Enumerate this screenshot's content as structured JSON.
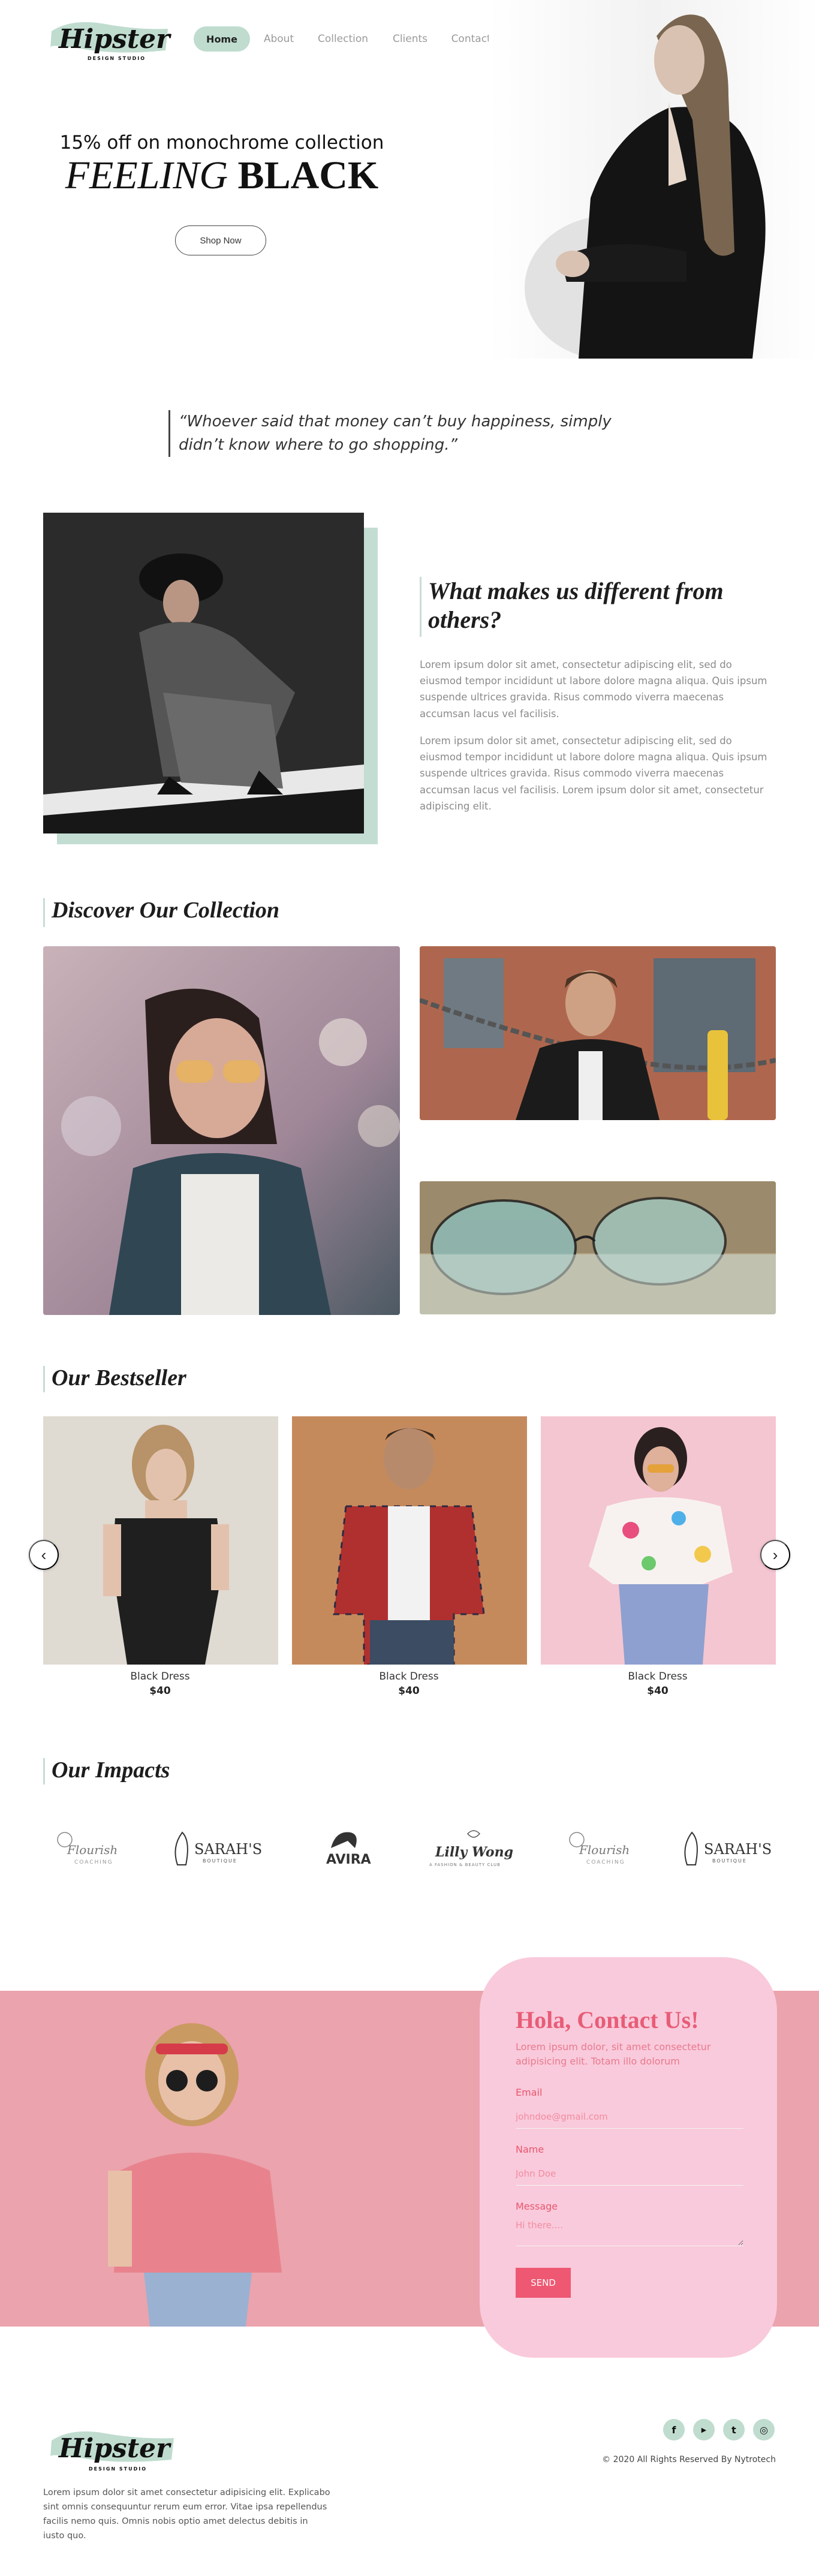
{
  "brand": {
    "logo_text": "Hipster",
    "logo_sub": "DESIGN STUDIO"
  },
  "nav": [
    {
      "label": "Home",
      "active": true
    },
    {
      "label": "About"
    },
    {
      "label": "Collection"
    },
    {
      "label": "Clients"
    },
    {
      "label": "Contact Us"
    }
  ],
  "hero": {
    "subtitle": "15% off on monochrome collection",
    "title_italic": "FEELING",
    "title_bold": "BLACK",
    "cta": "Shop Now"
  },
  "quote": "“Whoever said that money can’t buy happiness, simply didn’t know where to go shopping.”",
  "difference": {
    "title": "What makes us different from others?",
    "paragraphs": [
      "Lorem ipsum dolor sit amet, consectetur adipiscing elit, sed do eiusmod tempor incididunt ut labore dolore magna aliqua. Quis ipsum suspende ultrices gravida. Risus commodo viverra maecenas accumsan lacus vel facilisis.",
      "Lorem ipsum dolor sit amet, consectetur adipiscing elit, sed do eiusmod tempor incididunt ut labore dolore magna aliqua. Quis ipsum suspende ultrices gravida. Risus commodo viverra maecenas accumsan lacus vel facilisis. Lorem ipsum dolor sit amet, consectetur adipiscing elit."
    ]
  },
  "collection": {
    "title": "Discover Our Collection"
  },
  "bestseller": {
    "title": "Our Bestseller",
    "prev_icon": "‹",
    "next_icon": "›",
    "products": [
      {
        "name": "Black Dress",
        "price": "$40"
      },
      {
        "name": "Black Dress",
        "price": "$40"
      },
      {
        "name": "Black Dress",
        "price": "$40"
      }
    ]
  },
  "impacts": {
    "title": "Our Impacts",
    "brands": [
      {
        "name": "Flourish",
        "sub": "COACHING"
      },
      {
        "name": "SARAH'S",
        "sub": "BOUTIQUE"
      },
      {
        "name": "AVIRA",
        "sub": ""
      },
      {
        "name": "Lilly Wong",
        "sub": "A FASHION & BEAUTY CLUB"
      },
      {
        "name": "Flourish",
        "sub": "COACHING"
      },
      {
        "name": "SARAH'S",
        "sub": "BOUTIQUE"
      }
    ]
  },
  "contact": {
    "title": "Hola, Contact Us!",
    "subtitle": "Lorem ipsum dolor, sit amet consectetur adipisicing elit. Totam illo dolorum",
    "email_label": "Email",
    "email_placeholder": "johndoe@gmail.com",
    "name_label": "Name",
    "name_placeholder": "John Doe",
    "message_label": "Message",
    "message_placeholder": "Hi there....",
    "send": "SEND"
  },
  "footer": {
    "text": "Lorem ipsum dolor sit amet consectetur adipisicing elit. Explicabo sint omnis consequuntur rerum eum error. Vitae ipsa repellendus facilis nemo quis. Omnis nobis optio amet delectus debitis in iusto quo.",
    "copyright": "© 2020 All Rights Reserved By Nytrotech",
    "social": [
      "f",
      "▶",
      "t",
      "◎"
    ]
  },
  "colors": {
    "accent": "#bfdccf",
    "pink": "#f9cadb",
    "pink_bg": "#eba3ad",
    "contact_title": "#e85c77",
    "send": "#ee5872"
  }
}
